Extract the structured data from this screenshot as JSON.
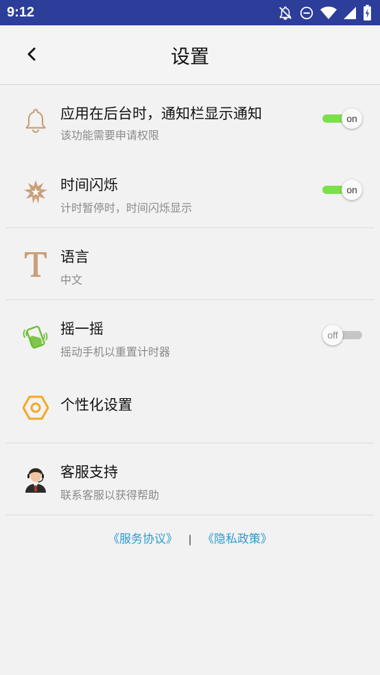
{
  "status_bar": {
    "time": "9:12",
    "icons": [
      "notifications-off-icon",
      "do-not-disturb-icon",
      "wifi-icon",
      "signal-icon",
      "battery-icon"
    ]
  },
  "header": {
    "title": "设置",
    "back_icon": "chevron-left-icon"
  },
  "settings": [
    {
      "icon": "bell-icon",
      "title": "应用在后台时，通知栏显示通知",
      "subtitle": "该功能需要申请权限",
      "toggle": "on"
    },
    {
      "icon": "star-burst-icon",
      "title": "时间闪烁",
      "subtitle": "计时暂停时，时间闪烁显示",
      "toggle": "on"
    },
    {
      "icon": "text-t-icon",
      "title": "语言",
      "subtitle": "中文"
    },
    {
      "icon": "shake-phone-icon",
      "title": "摇一摇",
      "subtitle": "摇动手机以重置计时器",
      "toggle": "off"
    },
    {
      "icon": "hexagon-icon",
      "title": "个性化设置"
    },
    {
      "icon": "support-agent-icon",
      "title": "客服支持",
      "subtitle": "联系客服以获得帮助"
    }
  ],
  "footer": {
    "service_agreement": "《服务协议》",
    "separator": "|",
    "privacy_policy": "《隐私政策》"
  },
  "colors": {
    "status_bar": "#2c3e9a",
    "toggle_on": "#7be04a",
    "toggle_off": "#c6c6c6",
    "link": "#2a9bd0",
    "icon_tan": "#c9a079",
    "icon_orange": "#f5a623",
    "icon_green": "#6cbe2f"
  }
}
